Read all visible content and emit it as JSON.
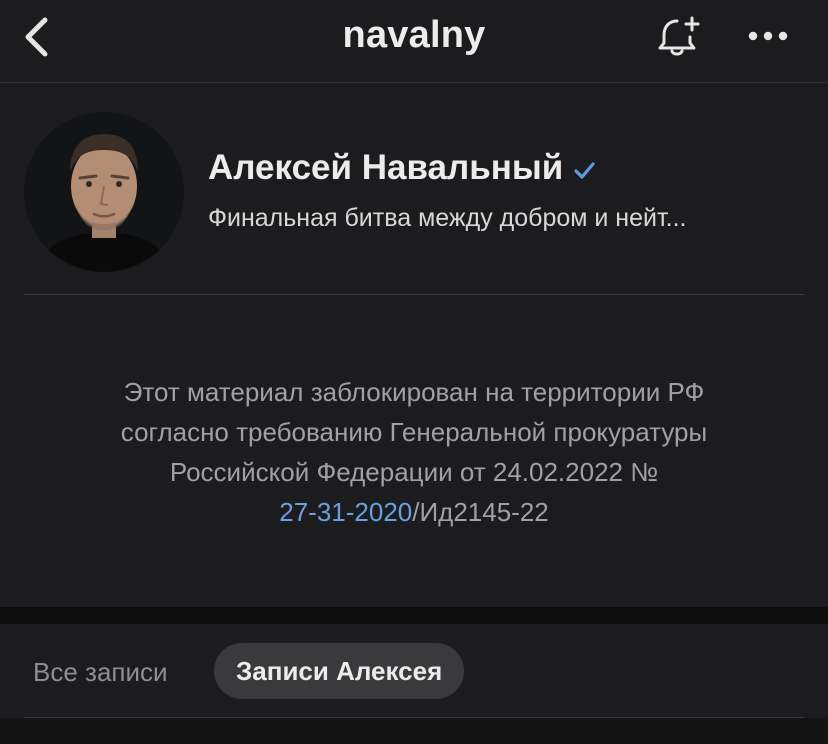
{
  "header": {
    "title": "navalny",
    "back_icon": "chevron-left-icon",
    "bell_icon": "bell-plus-icon",
    "more_icon": "more-dots-icon"
  },
  "profile": {
    "name": "Алексей Навальный",
    "verified": true,
    "status": "Финальная битва между добром и нейт...",
    "accent": "#5b9be6"
  },
  "blocked_notice": {
    "line1": "Этот материал заблокирован на территории РФ",
    "line2": "согласно требованию Генеральной прокуратуры",
    "line3": "Российской Федерации от 24.02.2022 №",
    "link_text": "27-31-2020",
    "suffix": "/Ид2145-22"
  },
  "tabs": [
    {
      "label": "Все записи",
      "active": false
    },
    {
      "label": "Записи Алексея",
      "active": true
    }
  ]
}
